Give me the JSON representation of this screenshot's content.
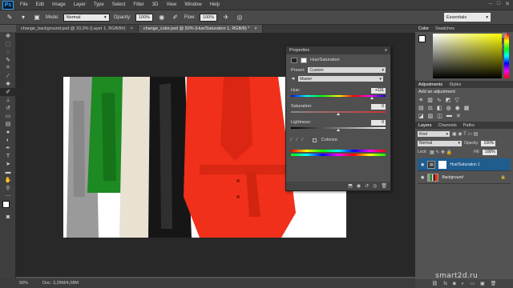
{
  "app": {
    "logo": "Ps"
  },
  "menu": [
    "File",
    "Edit",
    "Image",
    "Layer",
    "Type",
    "Select",
    "Filter",
    "3D",
    "View",
    "Window",
    "Help"
  ],
  "window_buttons": [
    "–",
    "□",
    "✕"
  ],
  "options": {
    "mode_label": "Mode:",
    "mode_value": "Normal",
    "opacity_label": "Opacity:",
    "opacity_value": "100%",
    "flow_label": "Flow:",
    "flow_value": "100%",
    "workspace": "Essentials"
  },
  "tabs": [
    {
      "label": "change_background.psd @ 33,3% (Layer 1, RGB/8#)",
      "active": false
    },
    {
      "label": "change_color.psd @ 50% (Hue/Saturation 1, RGB/8) *",
      "active": true
    }
  ],
  "status": {
    "zoom": "50%",
    "doc": "Doc: 3,29M/4,08M"
  },
  "properties": {
    "tab_label": "Properties",
    "adjustment_title": "Hue/Saturation",
    "preset_label": "Preset:",
    "preset_value": "Custom",
    "channel_value": "Master",
    "hue_label": "Hue:",
    "hue_value": "+131",
    "saturation_label": "Saturation:",
    "saturation_value": "0",
    "lightness_label": "Lightness:",
    "lightness_value": "0",
    "colorize_label": "Colorize",
    "hue_fraction": 0.86,
    "saturation_fraction": 0.5,
    "lightness_fraction": 0.5
  },
  "color_panel": {
    "tabs": [
      "Color",
      "Swatches"
    ]
  },
  "adjustments_panel": {
    "tabs": [
      "Adjustments",
      "Styles"
    ],
    "title": "Add an adjustment"
  },
  "layers_panel": {
    "tabs": [
      "Layers",
      "Channels",
      "Paths"
    ],
    "kind_label": "Kind",
    "blend_value": "Normal",
    "opacity_label": "Opacity:",
    "opacity_value": "100%",
    "lock_label": "Lock:",
    "fill_label": "Fill:",
    "fill_value": "100%",
    "layers": [
      {
        "name": "Hue/Saturation 1",
        "selected": true
      },
      {
        "name": "Background",
        "selected": false
      }
    ]
  },
  "watermark": "smart2d.ru",
  "colors": {
    "coat_red": "#f0301a",
    "coat_green": "#1d8a22",
    "coat_beige": "#e9e1d2",
    "coat_black": "#161616",
    "coat_gray": "#9a9a9a",
    "accent_blue": "#1f5d8f"
  }
}
